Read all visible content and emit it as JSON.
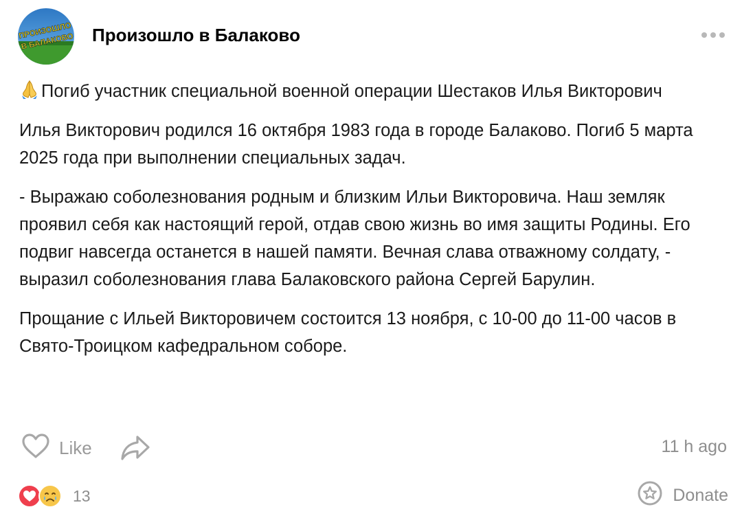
{
  "channel": {
    "name": "Произошло в Балаково",
    "avatar_text_line1": "ПРОИЗОШЛО",
    "avatar_text_line2": "В БАЛАКОВО"
  },
  "post": {
    "headline": "Погиб участник специальной военной операции Шестаков Илья Викторович",
    "paragraphs": [
      "Илья Викторович родился 16 октября 1983 года в городе Балаково. Погиб 5 марта 2025 года при выполнении специальных задач.",
      "- Выражаю соболезнования родным и близким Ильи Викторовича. Наш земляк проявил себя как настоящий герой, отдав свою жизнь во имя защиты Родины. Его подвиг навсегда останется в нашей памяти. Вечная слава отважному солдату, - выразил соболезнования глава Балаковского района Сергей Барулин.",
      "Прощание с Ильей Викторовичем состоится 13 ноября, с 10-00 до 11-00 часов в Свято-Троицком кафедральном соборе."
    ]
  },
  "actions": {
    "like_label": "Like",
    "timestamp": "11 h ago"
  },
  "reactions": {
    "count": "13",
    "icons": [
      "heart-icon",
      "crying-face-icon"
    ]
  },
  "donate_label": "Donate",
  "icons": {
    "headline": "folded-hands-icon",
    "more": "more-dots-icon",
    "like": "heart-outline-icon",
    "share": "share-arrow-icon",
    "donate": "star-badge-icon"
  },
  "colors": {
    "muted_text": "#8e8e8e",
    "icon_gray": "#a8a8a8",
    "heart_red": "#ef3f4d",
    "emoji_yellow": "#f7c64a"
  }
}
